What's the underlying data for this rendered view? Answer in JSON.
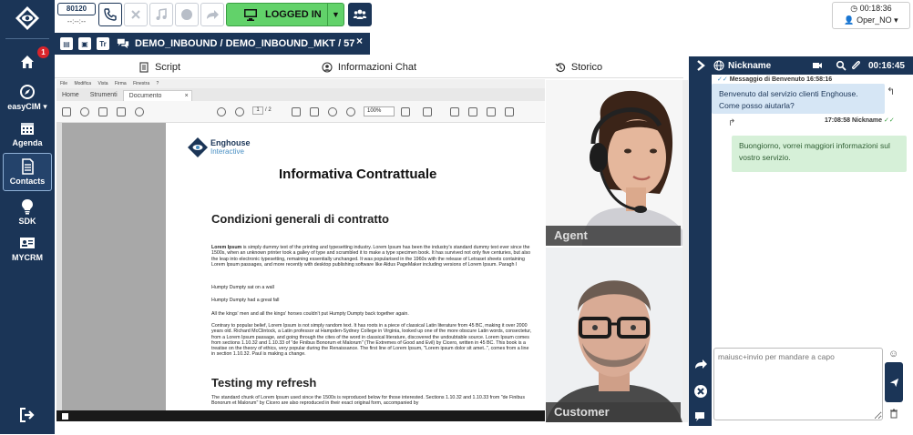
{
  "nav": {
    "items": [
      {
        "label": "",
        "icon": "home-icon",
        "badge": "1"
      },
      {
        "label": "easyCIM ▾",
        "icon": "compass-icon"
      },
      {
        "label": "Agenda",
        "icon": "calendar-icon"
      },
      {
        "label": "Contacts",
        "icon": "contacts-icon"
      },
      {
        "label": "SDK",
        "icon": "bulb-icon"
      },
      {
        "label": "MYCRM",
        "icon": "id-card-icon"
      }
    ],
    "logout_icon": "logout-icon"
  },
  "topbar": {
    "extension": "80120",
    "extension_sub": "--:--:--",
    "login_label": "LOGGED IN",
    "clock": "00:18:36",
    "operator": "Oper_NO ▾"
  },
  "tab": {
    "title": "DEMO_INBOUND / DEMO_INBOUND_MKT / 57",
    "close": "×",
    "icon_tt": "Tr"
  },
  "subtabs": [
    {
      "label": "Script",
      "icon": "document-icon"
    },
    {
      "label": "Informazioni Chat",
      "icon": "user-icon"
    },
    {
      "label": "Storico",
      "icon": "history-icon"
    }
  ],
  "viewer": {
    "menu": [
      "File",
      "Modifica",
      "Vista",
      "Firma",
      "Finestra",
      "?"
    ],
    "tabs": [
      "Home",
      "Strumenti",
      "Documento Inform..."
    ],
    "page_current": "1",
    "page_total": "/ 2",
    "zoom": "100%",
    "brand1": "Enghouse",
    "brand2": "Interactive",
    "doc_title": "Informativa Contrattuale",
    "heading1": "Condizioni generali di contratto",
    "p1_bold": "Lorem Ipsum",
    "p1": " is simply dummy text of the printing and typesetting industry. Lorem Ipsum has been the industry's standard dummy text ever since the 1500s, when an unknown printer took a galley of type and scrambled it to make a type specimen book. It has survived not only five centuries, but also the leap into electronic typesetting, remaining essentially unchanged. It was popularised in the 1960s with the release of Letraset sheets containing Lorem Ipsum passages, and more recently with desktop publishing software like Aldus PageMaker including versions of Lorem Ipsum. Paragh I",
    "p2": "Humpty Dumpty sat on a wall",
    "p3": "Humpty Dumpty had a great fall",
    "p4": "All the kings' men and all the kings' horses couldn't put Humpty Dumpty back together again.",
    "p5": "Contrary to popular belief, Lorem Ipsum is not simply random text. It has roots in a piece of classical Latin literature from 45 BC, making it over 2000 years old. Richard McClintock, a Latin professor at Hampden-Sydney College in Virginia, looked up one of the more obscure Latin words, consectetur, from a Lorem Ipsum passage, and going through the cites of the word in classical literature, discovered the undoubtable source. Lorem Ipsum comes from sections 1.10.32 and 1.10.33 of \"de Finibus Bonorum et Malorum\" (The Extremes of Good and Evil) by Cicero, written in 45 BC. This book is a treatise on the theory of ethics, very popular during the Renaissance. The first line of Lorem Ipsum, \"Lorem ipsum dolor sit amet..\", comes from a line in section 1.10.32. Paul is making a change.",
    "heading2": "Testing my refresh",
    "p6": "The standard chunk of Lorem Ipsum used since the 1500s is reproduced below for those interested. Sections 1.10.32 and 1.10.33 from \"de Finibus Bonorum et Malorum\" by Cicero are also reproduced in their exact original form, accompanied by"
  },
  "video": {
    "agent_label": "Agent",
    "customer_label": "Customer"
  },
  "chat": {
    "nickname": "Nickname",
    "timer": "00:16:45",
    "msg1_meta": "Messaggio di Benvenuto 16:58:16",
    "msg1": "Benvenuto dal servizio clienti Enghouse. Come posso aiutarla?",
    "msg2_meta": "17:08:58 Nickname",
    "msg2": "Buongiorno, vorrei maggiori informazioni sul vostro servizio.",
    "input_placeholder": "maiusc+invio per mandare a capo"
  },
  "colors": {
    "navy": "#1b3557",
    "login_green": "#62d26a",
    "badge_red": "#d9242b",
    "bubble_in": "#d6e6f5",
    "bubble_out": "#d6f0d8"
  }
}
